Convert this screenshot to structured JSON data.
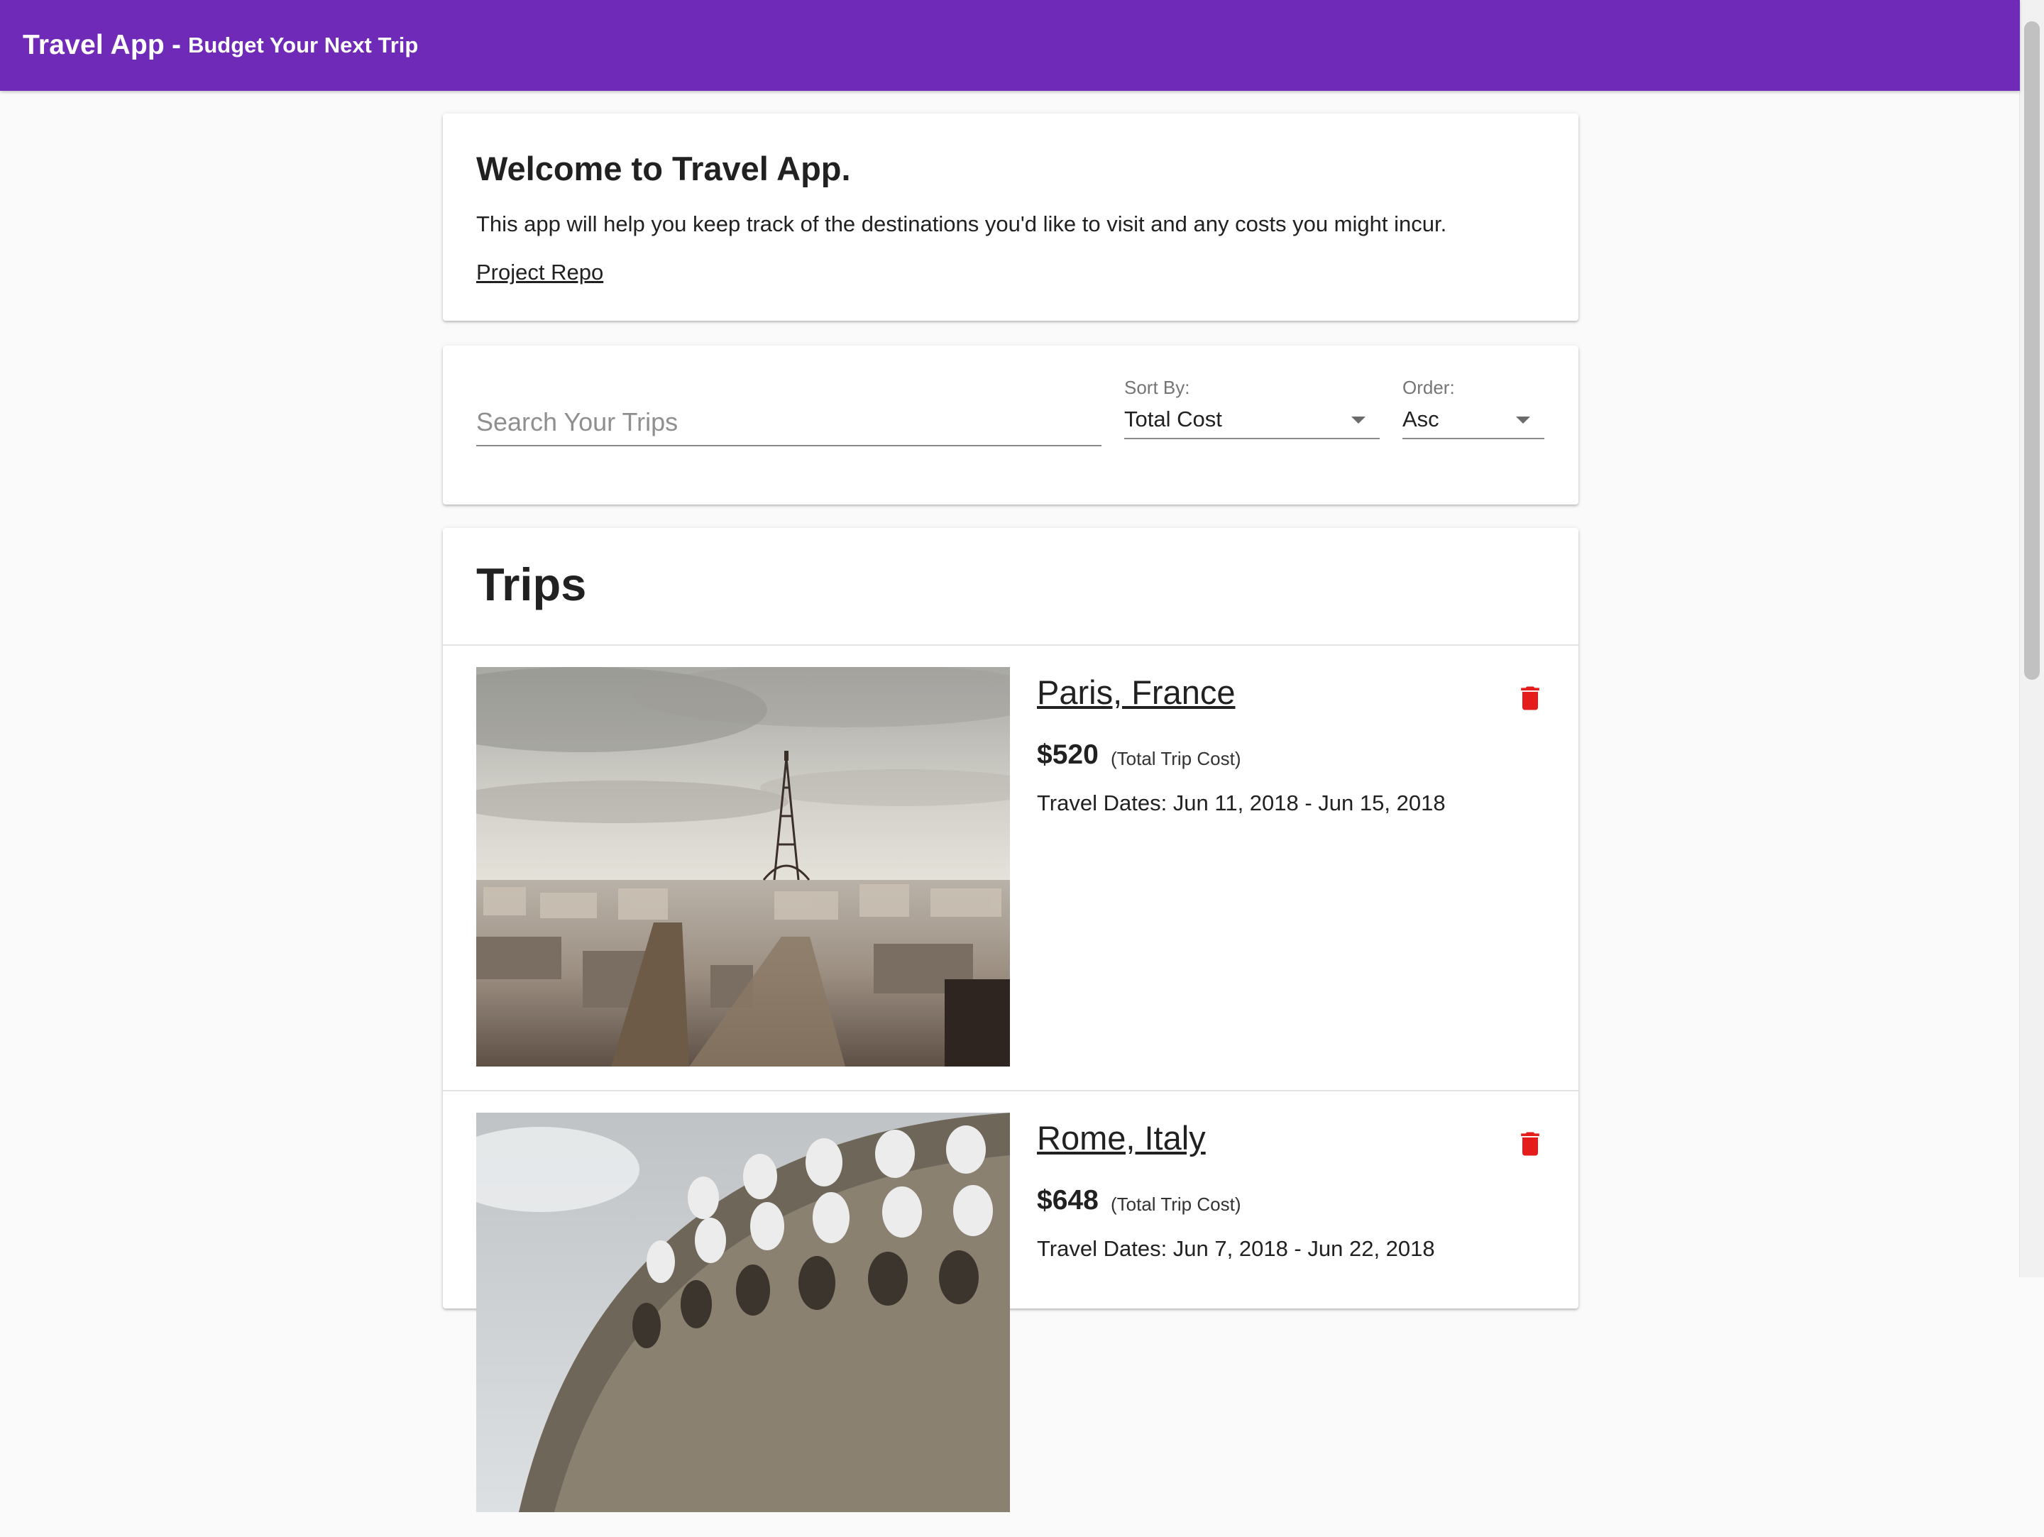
{
  "appbar": {
    "title": "Travel App",
    "separator": "-",
    "subtitle": "Budget Your Next Trip",
    "color": "#6f2ab8"
  },
  "welcome": {
    "heading": "Welcome to Travel App.",
    "body": "This app will help you keep track of the destinations you'd like to visit and any costs you might incur.",
    "repo_link": "Project Repo"
  },
  "filters": {
    "search_placeholder": "Search Your Trips",
    "sort_label": "Sort By:",
    "sort_value": "Total Cost",
    "order_label": "Order:",
    "order_value": "Asc"
  },
  "trips": {
    "heading": "Trips",
    "items": [
      {
        "destination": "Paris, France",
        "cost": "$520",
        "cost_note": "(Total Trip Cost)",
        "dates": "Travel Dates: Jun 11, 2018 - Jun 15, 2018",
        "image": "eiffel-tower-photo"
      },
      {
        "destination": "Rome, Italy",
        "cost": "$648",
        "cost_note": "(Total Trip Cost)",
        "dates": "Travel Dates: Jun 7, 2018 - Jun 22, 2018",
        "image": "colosseum-photo"
      }
    ]
  },
  "icons": {
    "delete": "trash-icon",
    "dropdown": "caret-down-icon"
  },
  "colors": {
    "delete_icon": "#e51c1c",
    "background": "#fafafa"
  }
}
